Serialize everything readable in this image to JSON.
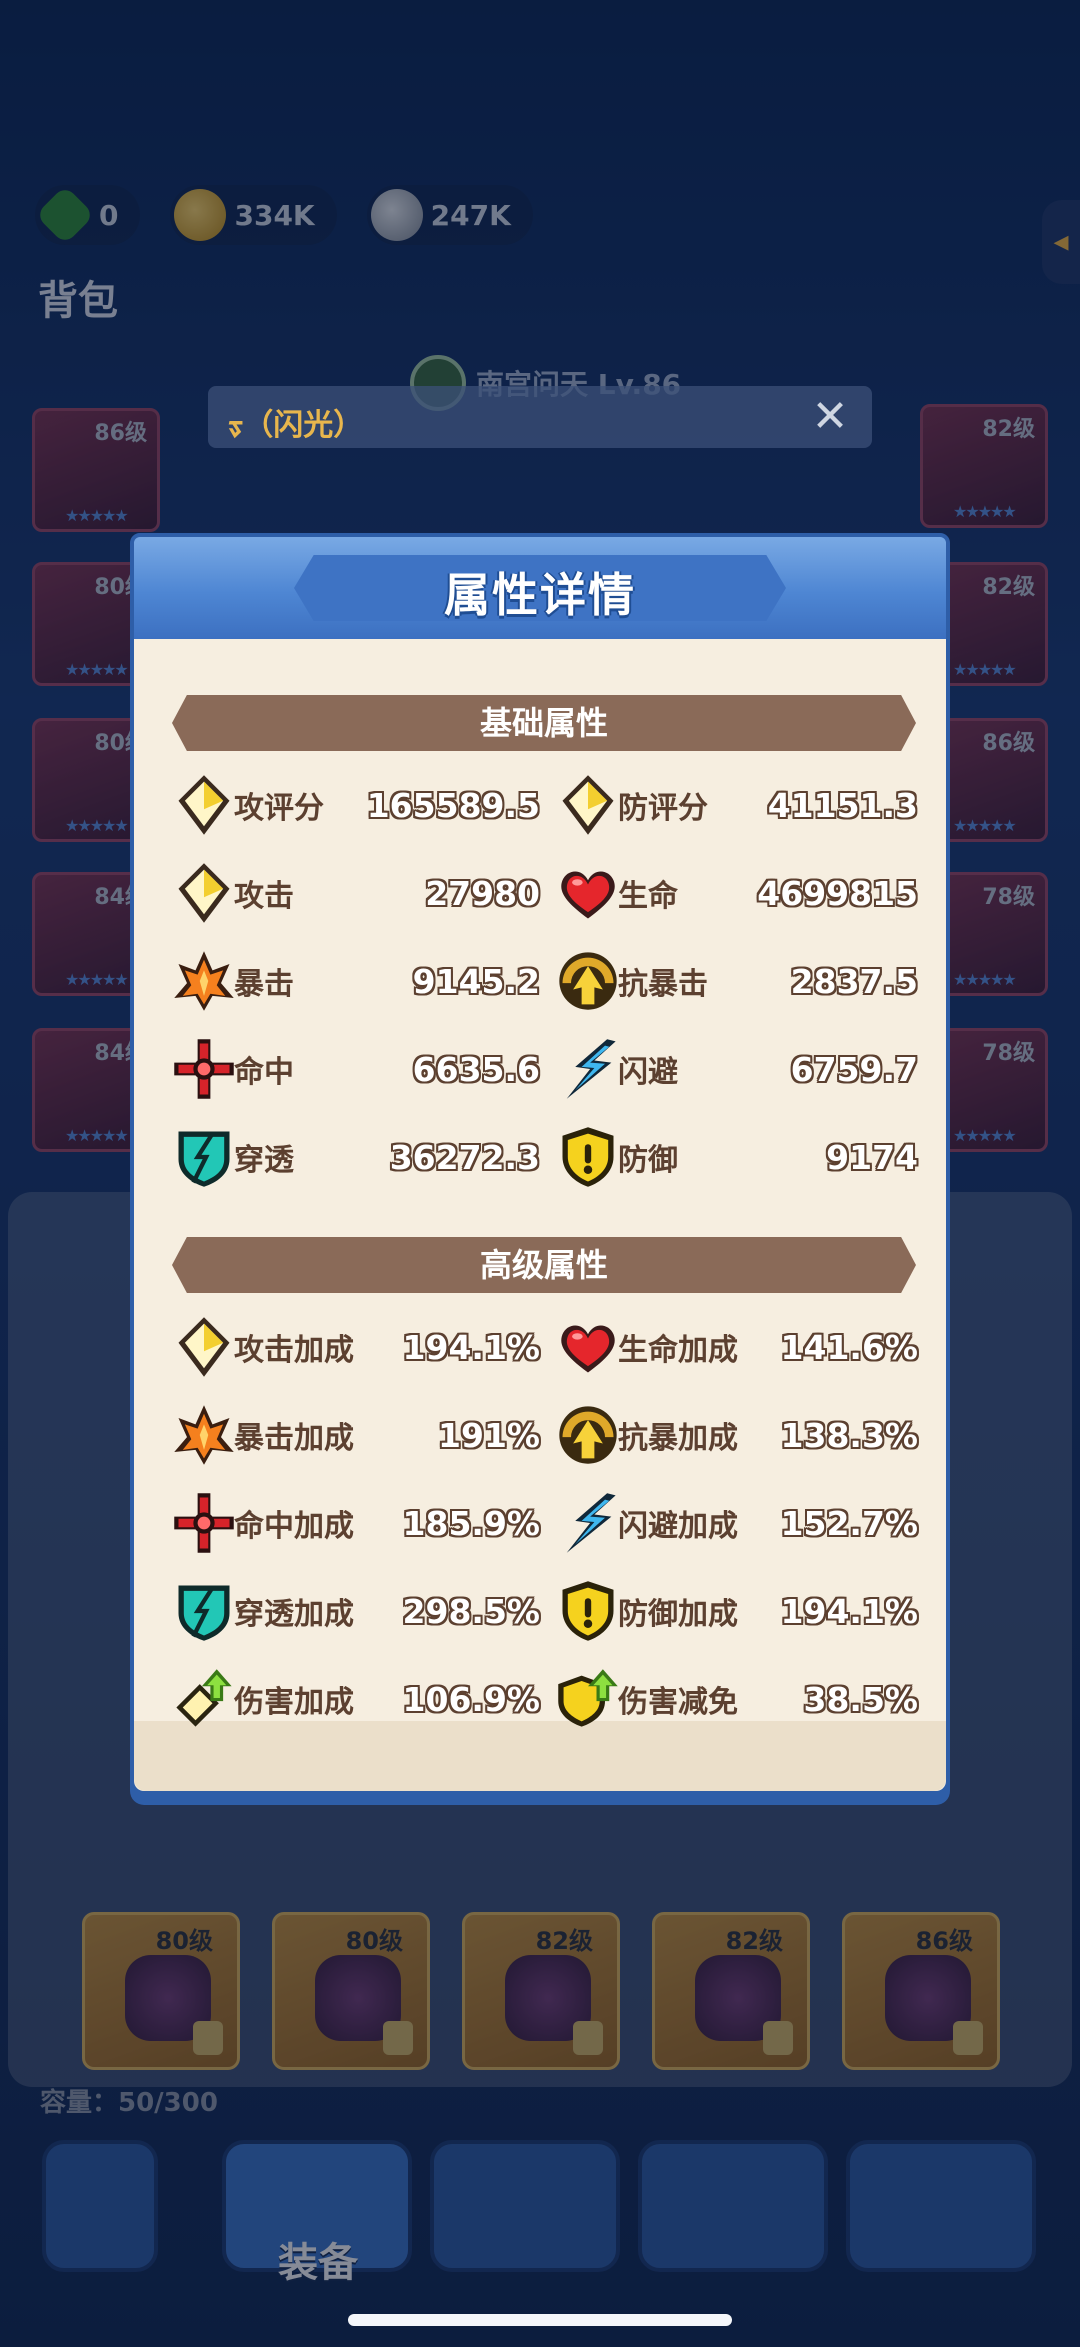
{
  "currencies": [
    {
      "icon": "green-gem-icon",
      "value": "0"
    },
    {
      "icon": "gold-coin-icon",
      "value": "334K"
    },
    {
      "icon": "silver-coin-icon",
      "value": "247K"
    }
  ],
  "bag": {
    "title": "背包"
  },
  "character": {
    "name": "南宫问天 Lv.86"
  },
  "search": {
    "text": "ᢌ（闪光）"
  },
  "left_slots": [
    "86级",
    "80级",
    "80级",
    "84级",
    "84级"
  ],
  "right_slots": [
    "82级",
    "82级",
    "86级",
    "78级",
    "78级"
  ],
  "inventory_levels": [
    "80级",
    "80级",
    "82级",
    "82级",
    "86级"
  ],
  "capacity": "容量：50/300",
  "nav": {
    "equip_label": "装备"
  },
  "modal": {
    "title": "属性详情",
    "basic": {
      "title": "基础属性",
      "stats": [
        {
          "icon": "attack-score-icon",
          "label": "攻评分",
          "value": "165589.5"
        },
        {
          "icon": "defense-score-icon",
          "label": "防评分",
          "value": "41151.3"
        },
        {
          "icon": "attack-icon",
          "label": "攻击",
          "value": "27980"
        },
        {
          "icon": "heart-icon",
          "label": "生命",
          "value": "4699815"
        },
        {
          "icon": "crit-icon",
          "label": "暴击",
          "value": "9145.2"
        },
        {
          "icon": "anti-crit-icon",
          "label": "抗暴击",
          "value": "2837.5"
        },
        {
          "icon": "crosshair-icon",
          "label": "命中",
          "value": "6635.6"
        },
        {
          "icon": "dodge-icon",
          "label": "闪避",
          "value": "6759.7"
        },
        {
          "icon": "penetrate-icon",
          "label": "穿透",
          "value": "36272.3"
        },
        {
          "icon": "shield-icon",
          "label": "防御",
          "value": "9174"
        }
      ]
    },
    "advanced": {
      "title": "高级属性",
      "stats": [
        {
          "icon": "attack-icon",
          "label": "攻击加成",
          "value": "194.1%"
        },
        {
          "icon": "heart-icon",
          "label": "生命加成",
          "value": "141.6%"
        },
        {
          "icon": "crit-icon",
          "label": "暴击加成",
          "value": "191%"
        },
        {
          "icon": "anti-crit-icon",
          "label": "抗暴加成",
          "value": "138.3%"
        },
        {
          "icon": "crosshair-icon",
          "label": "命中加成",
          "value": "185.9%"
        },
        {
          "icon": "dodge-icon",
          "label": "闪避加成",
          "value": "152.7%"
        },
        {
          "icon": "penetrate-icon",
          "label": "穿透加成",
          "value": "298.5%"
        },
        {
          "icon": "shield-icon",
          "label": "防御加成",
          "value": "194.1%"
        },
        {
          "icon": "damage-up-icon",
          "label": "伤害加成",
          "value": "106.9%"
        },
        {
          "icon": "damage-reduce-icon",
          "label": "伤害减免",
          "value": "38.5%"
        }
      ]
    }
  }
}
